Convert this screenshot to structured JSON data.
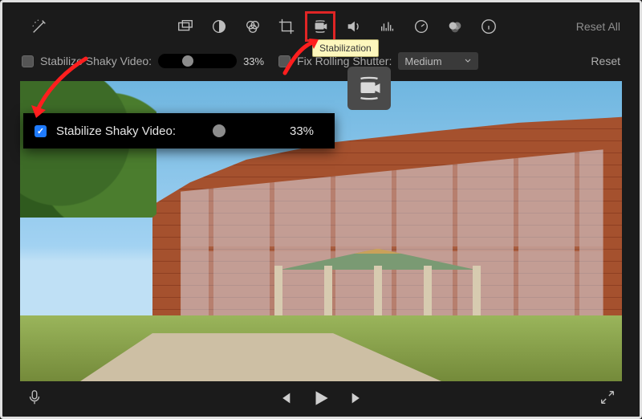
{
  "toolbar": {
    "reset_all": "Reset All",
    "tooltip": "Stabilization"
  },
  "settings": {
    "stabilize_label": "Stabilize Shaky Video:",
    "stabilize_percent": "33%",
    "fix_rolling_label": "Fix Rolling Shutter:",
    "fix_rolling_value": "Medium",
    "reset": "Reset"
  },
  "magnify": {
    "stabilize_label": "Stabilize Shaky Video:",
    "stabilize_percent": "33%"
  }
}
